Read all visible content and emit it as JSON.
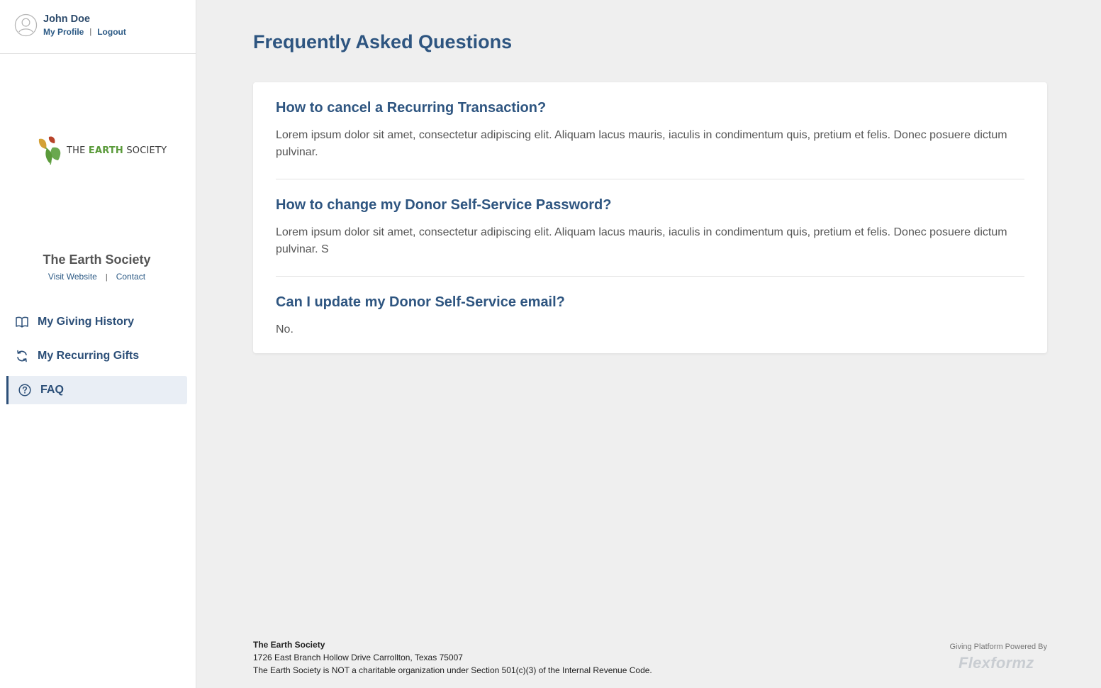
{
  "user": {
    "name": "John Doe",
    "profile_link": "My Profile",
    "logout_link": "Logout",
    "separator": "|"
  },
  "brand": {
    "logo_text_pre": "THE ",
    "logo_text_earth": "EARTH",
    "logo_text_post": " SOCIETY",
    "org_name": "The Earth Society",
    "visit_website": "Visit Website",
    "contact": "Contact",
    "separator": "|",
    "accent_color": "#2e5580"
  },
  "nav": {
    "items": [
      {
        "label": "My Giving History",
        "icon": "book-icon",
        "active": false
      },
      {
        "label": "My Recurring Gifts",
        "icon": "refresh-icon",
        "active": false
      },
      {
        "label": "FAQ",
        "icon": "question-circle-icon",
        "active": true
      }
    ]
  },
  "main": {
    "title": "Frequently Asked Questions",
    "faqs": [
      {
        "question": "How to cancel a Recurring Transaction?",
        "answer": "Lorem ipsum dolor sit amet, consectetur adipiscing elit. Aliquam lacus mauris, iaculis in condimentum quis, pretium et felis. Donec posuere dictum pulvinar."
      },
      {
        "question": "How to change my Donor Self-Service Password?",
        "answer": "Lorem ipsum dolor sit amet, consectetur adipiscing elit. Aliquam lacus mauris, iaculis in condimentum quis, pretium et felis. Donec posuere dictum pulvinar. S"
      },
      {
        "question": "Can I update my Donor Self-Service email?",
        "answer": "No."
      }
    ]
  },
  "footer": {
    "org_name": "The Earth Society",
    "address": "1726 East Branch Hollow Drive Carrollton, Texas 75007",
    "disclaimer": "The Earth Society is NOT a charitable organization under Section 501(c)(3) of the Internal Revenue Code.",
    "powered_by": "Giving Platform Powered By",
    "platform_name": "Flexformz"
  }
}
